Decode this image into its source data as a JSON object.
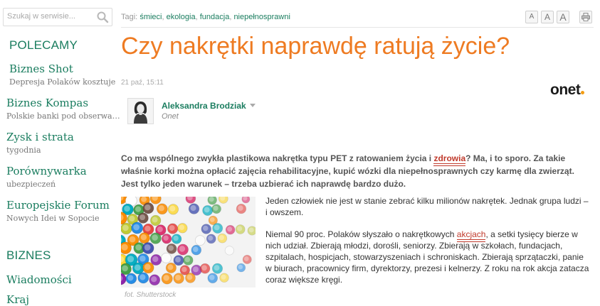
{
  "search": {
    "placeholder": "Szukaj w serwisie..."
  },
  "sidebar": {
    "section1": "POLECAMY",
    "items": [
      {
        "title": "Biznes Shot",
        "subtitle": "Depresja Polaków kosztuje"
      },
      {
        "title": "Biznes Kompas",
        "subtitle": "Polskie banki pod obserwacją"
      },
      {
        "title": "Zysk i strata",
        "subtitle": "tygodnia"
      },
      {
        "title": "Porównywarka",
        "subtitle": "ubezpieczeń"
      },
      {
        "title": "Europejskie Forum",
        "subtitle": "Nowych Idei w Sopocie"
      }
    ],
    "section2": "BIZNES",
    "items2": [
      {
        "title": "Wiadomości"
      },
      {
        "title": "Kraj"
      }
    ]
  },
  "article": {
    "tags_label": "Tagi:",
    "tags": [
      "śmieci",
      "ekologia",
      "fundacja",
      "niepełnosprawni"
    ],
    "tags_separator": ", ",
    "font_tools": [
      "A",
      "A",
      "A"
    ],
    "title": "Czy nakrętki naprawdę ratują życie?",
    "date": "21 paź, 15:11",
    "source_logo": "onet",
    "author": {
      "name": "Aleksandra Brodziak",
      "source": "Onet"
    },
    "lead": {
      "before": "Co ma wspólnego zwykła plastikowa nakrętka typu PET z ratowaniem życia i ",
      "link": "zdrowia",
      "after": "? Ma, i to sporo. Za takie właśnie korki można opłacić zajęcia rehabilitacyjne, kupić wózki dla niepełnosprawnych czy karmę dla zwierząt. Jest tylko jeden warunek – trzeba uzbierać ich naprawdę bardzo dużo."
    },
    "photo_caption": "fot. Shutterstock",
    "para1": "Jeden człowiek nie jest w stanie zebrać kilku milionów nakrętek. Jednak grupa ludzi – i owszem.",
    "para2": {
      "before": "Niemal 90 proc. Polaków słyszało o nakrętkowych ",
      "link": "akcjach",
      "after": ", a setki tysięcy bierze w nich udział. Zbierają młodzi, dorośli, seniorzy. Zbierają w szkołach, fundacjach, szpitalach, hospicjach, stowarzyszeniach i schroniskach. Zbierają sprzątaczki, panie w biurach, pracownicy firm, dyrektorzy, prezesi i kelnerzy. Z roku na rok akcja zatacza coraz większe kręgi."
    }
  },
  "colors": {
    "accent_green": "#1a7d5f",
    "headline_orange": "#ee7b22",
    "link_red": "#c0392b"
  }
}
